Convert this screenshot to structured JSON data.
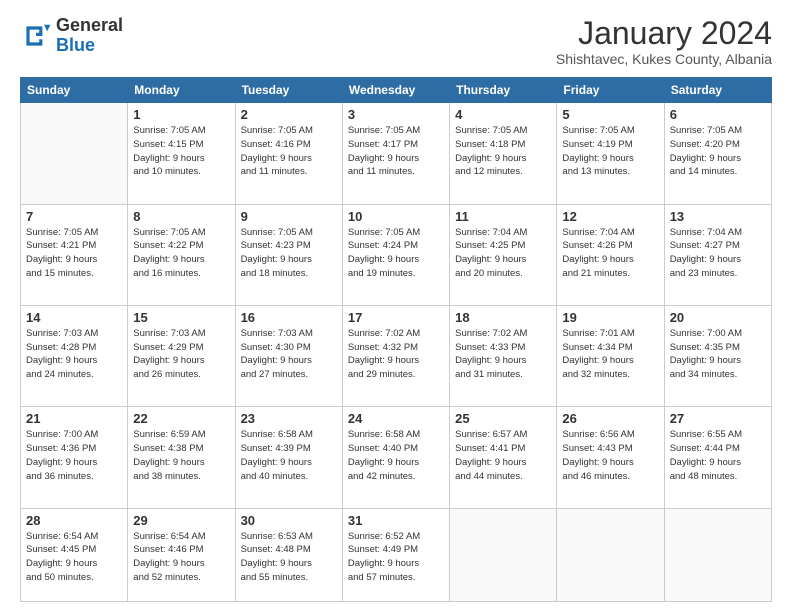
{
  "header": {
    "logo_line1": "General",
    "logo_line2": "Blue",
    "month_title": "January 2024",
    "subtitle": "Shishtavec, Kukes County, Albania"
  },
  "days_of_week": [
    "Sunday",
    "Monday",
    "Tuesday",
    "Wednesday",
    "Thursday",
    "Friday",
    "Saturday"
  ],
  "weeks": [
    [
      {
        "day": "",
        "info": ""
      },
      {
        "day": "1",
        "info": "Sunrise: 7:05 AM\nSunset: 4:15 PM\nDaylight: 9 hours\nand 10 minutes."
      },
      {
        "day": "2",
        "info": "Sunrise: 7:05 AM\nSunset: 4:16 PM\nDaylight: 9 hours\nand 11 minutes."
      },
      {
        "day": "3",
        "info": "Sunrise: 7:05 AM\nSunset: 4:17 PM\nDaylight: 9 hours\nand 11 minutes."
      },
      {
        "day": "4",
        "info": "Sunrise: 7:05 AM\nSunset: 4:18 PM\nDaylight: 9 hours\nand 12 minutes."
      },
      {
        "day": "5",
        "info": "Sunrise: 7:05 AM\nSunset: 4:19 PM\nDaylight: 9 hours\nand 13 minutes."
      },
      {
        "day": "6",
        "info": "Sunrise: 7:05 AM\nSunset: 4:20 PM\nDaylight: 9 hours\nand 14 minutes."
      }
    ],
    [
      {
        "day": "7",
        "info": ""
      },
      {
        "day": "8",
        "info": "Sunrise: 7:05 AM\nSunset: 4:22 PM\nDaylight: 9 hours\nand 16 minutes."
      },
      {
        "day": "9",
        "info": "Sunrise: 7:05 AM\nSunset: 4:23 PM\nDaylight: 9 hours\nand 18 minutes."
      },
      {
        "day": "10",
        "info": "Sunrise: 7:05 AM\nSunset: 4:24 PM\nDaylight: 9 hours\nand 19 minutes."
      },
      {
        "day": "11",
        "info": "Sunrise: 7:04 AM\nSunset: 4:25 PM\nDaylight: 9 hours\nand 20 minutes."
      },
      {
        "day": "12",
        "info": "Sunrise: 7:04 AM\nSunset: 4:26 PM\nDaylight: 9 hours\nand 21 minutes."
      },
      {
        "day": "13",
        "info": "Sunrise: 7:04 AM\nSunset: 4:27 PM\nDaylight: 9 hours\nand 23 minutes."
      }
    ],
    [
      {
        "day": "14",
        "info": ""
      },
      {
        "day": "15",
        "info": "Sunrise: 7:03 AM\nSunset: 4:29 PM\nDaylight: 9 hours\nand 26 minutes."
      },
      {
        "day": "16",
        "info": "Sunrise: 7:03 AM\nSunset: 4:30 PM\nDaylight: 9 hours\nand 27 minutes."
      },
      {
        "day": "17",
        "info": "Sunrise: 7:02 AM\nSunset: 4:32 PM\nDaylight: 9 hours\nand 29 minutes."
      },
      {
        "day": "18",
        "info": "Sunrise: 7:02 AM\nSunset: 4:33 PM\nDaylight: 9 hours\nand 31 minutes."
      },
      {
        "day": "19",
        "info": "Sunrise: 7:01 AM\nSunset: 4:34 PM\nDaylight: 9 hours\nand 32 minutes."
      },
      {
        "day": "20",
        "info": "Sunrise: 7:00 AM\nSunset: 4:35 PM\nDaylight: 9 hours\nand 34 minutes."
      }
    ],
    [
      {
        "day": "21",
        "info": ""
      },
      {
        "day": "22",
        "info": "Sunrise: 6:59 AM\nSunset: 4:38 PM\nDaylight: 9 hours\nand 38 minutes."
      },
      {
        "day": "23",
        "info": "Sunrise: 6:58 AM\nSunset: 4:39 PM\nDaylight: 9 hours\nand 40 minutes."
      },
      {
        "day": "24",
        "info": "Sunrise: 6:58 AM\nSunset: 4:40 PM\nDaylight: 9 hours\nand 42 minutes."
      },
      {
        "day": "25",
        "info": "Sunrise: 6:57 AM\nSunset: 4:41 PM\nDaylight: 9 hours\nand 44 minutes."
      },
      {
        "day": "26",
        "info": "Sunrise: 6:56 AM\nSunset: 4:43 PM\nDaylight: 9 hours\nand 46 minutes."
      },
      {
        "day": "27",
        "info": "Sunrise: 6:55 AM\nSunset: 4:44 PM\nDaylight: 9 hours\nand 48 minutes."
      }
    ],
    [
      {
        "day": "28",
        "info": ""
      },
      {
        "day": "29",
        "info": "Sunrise: 6:54 AM\nSunset: 4:46 PM\nDaylight: 9 hours\nand 52 minutes."
      },
      {
        "day": "30",
        "info": "Sunrise: 6:53 AM\nSunset: 4:48 PM\nDaylight: 9 hours\nand 55 minutes."
      },
      {
        "day": "31",
        "info": "Sunrise: 6:52 AM\nSunset: 4:49 PM\nDaylight: 9 hours\nand 57 minutes."
      },
      {
        "day": "",
        "info": ""
      },
      {
        "day": "",
        "info": ""
      },
      {
        "day": "",
        "info": ""
      }
    ]
  ],
  "week1_day7_info": "Sunrise: 7:05 AM\nSunset: 4:21 PM\nDaylight: 9 hours\nand 15 minutes.",
  "week2_day14_info": "Sunrise: 7:03 AM\nSunset: 4:28 PM\nDaylight: 9 hours\nand 24 minutes.",
  "week3_day21_info": "Sunrise: 7:00 AM\nSunset: 4:36 PM\nDaylight: 9 hours\nand 36 minutes.",
  "week4_day28_info": "Sunrise: 6:54 AM\nSunset: 4:45 PM\nDaylight: 9 hours\nand 50 minutes."
}
